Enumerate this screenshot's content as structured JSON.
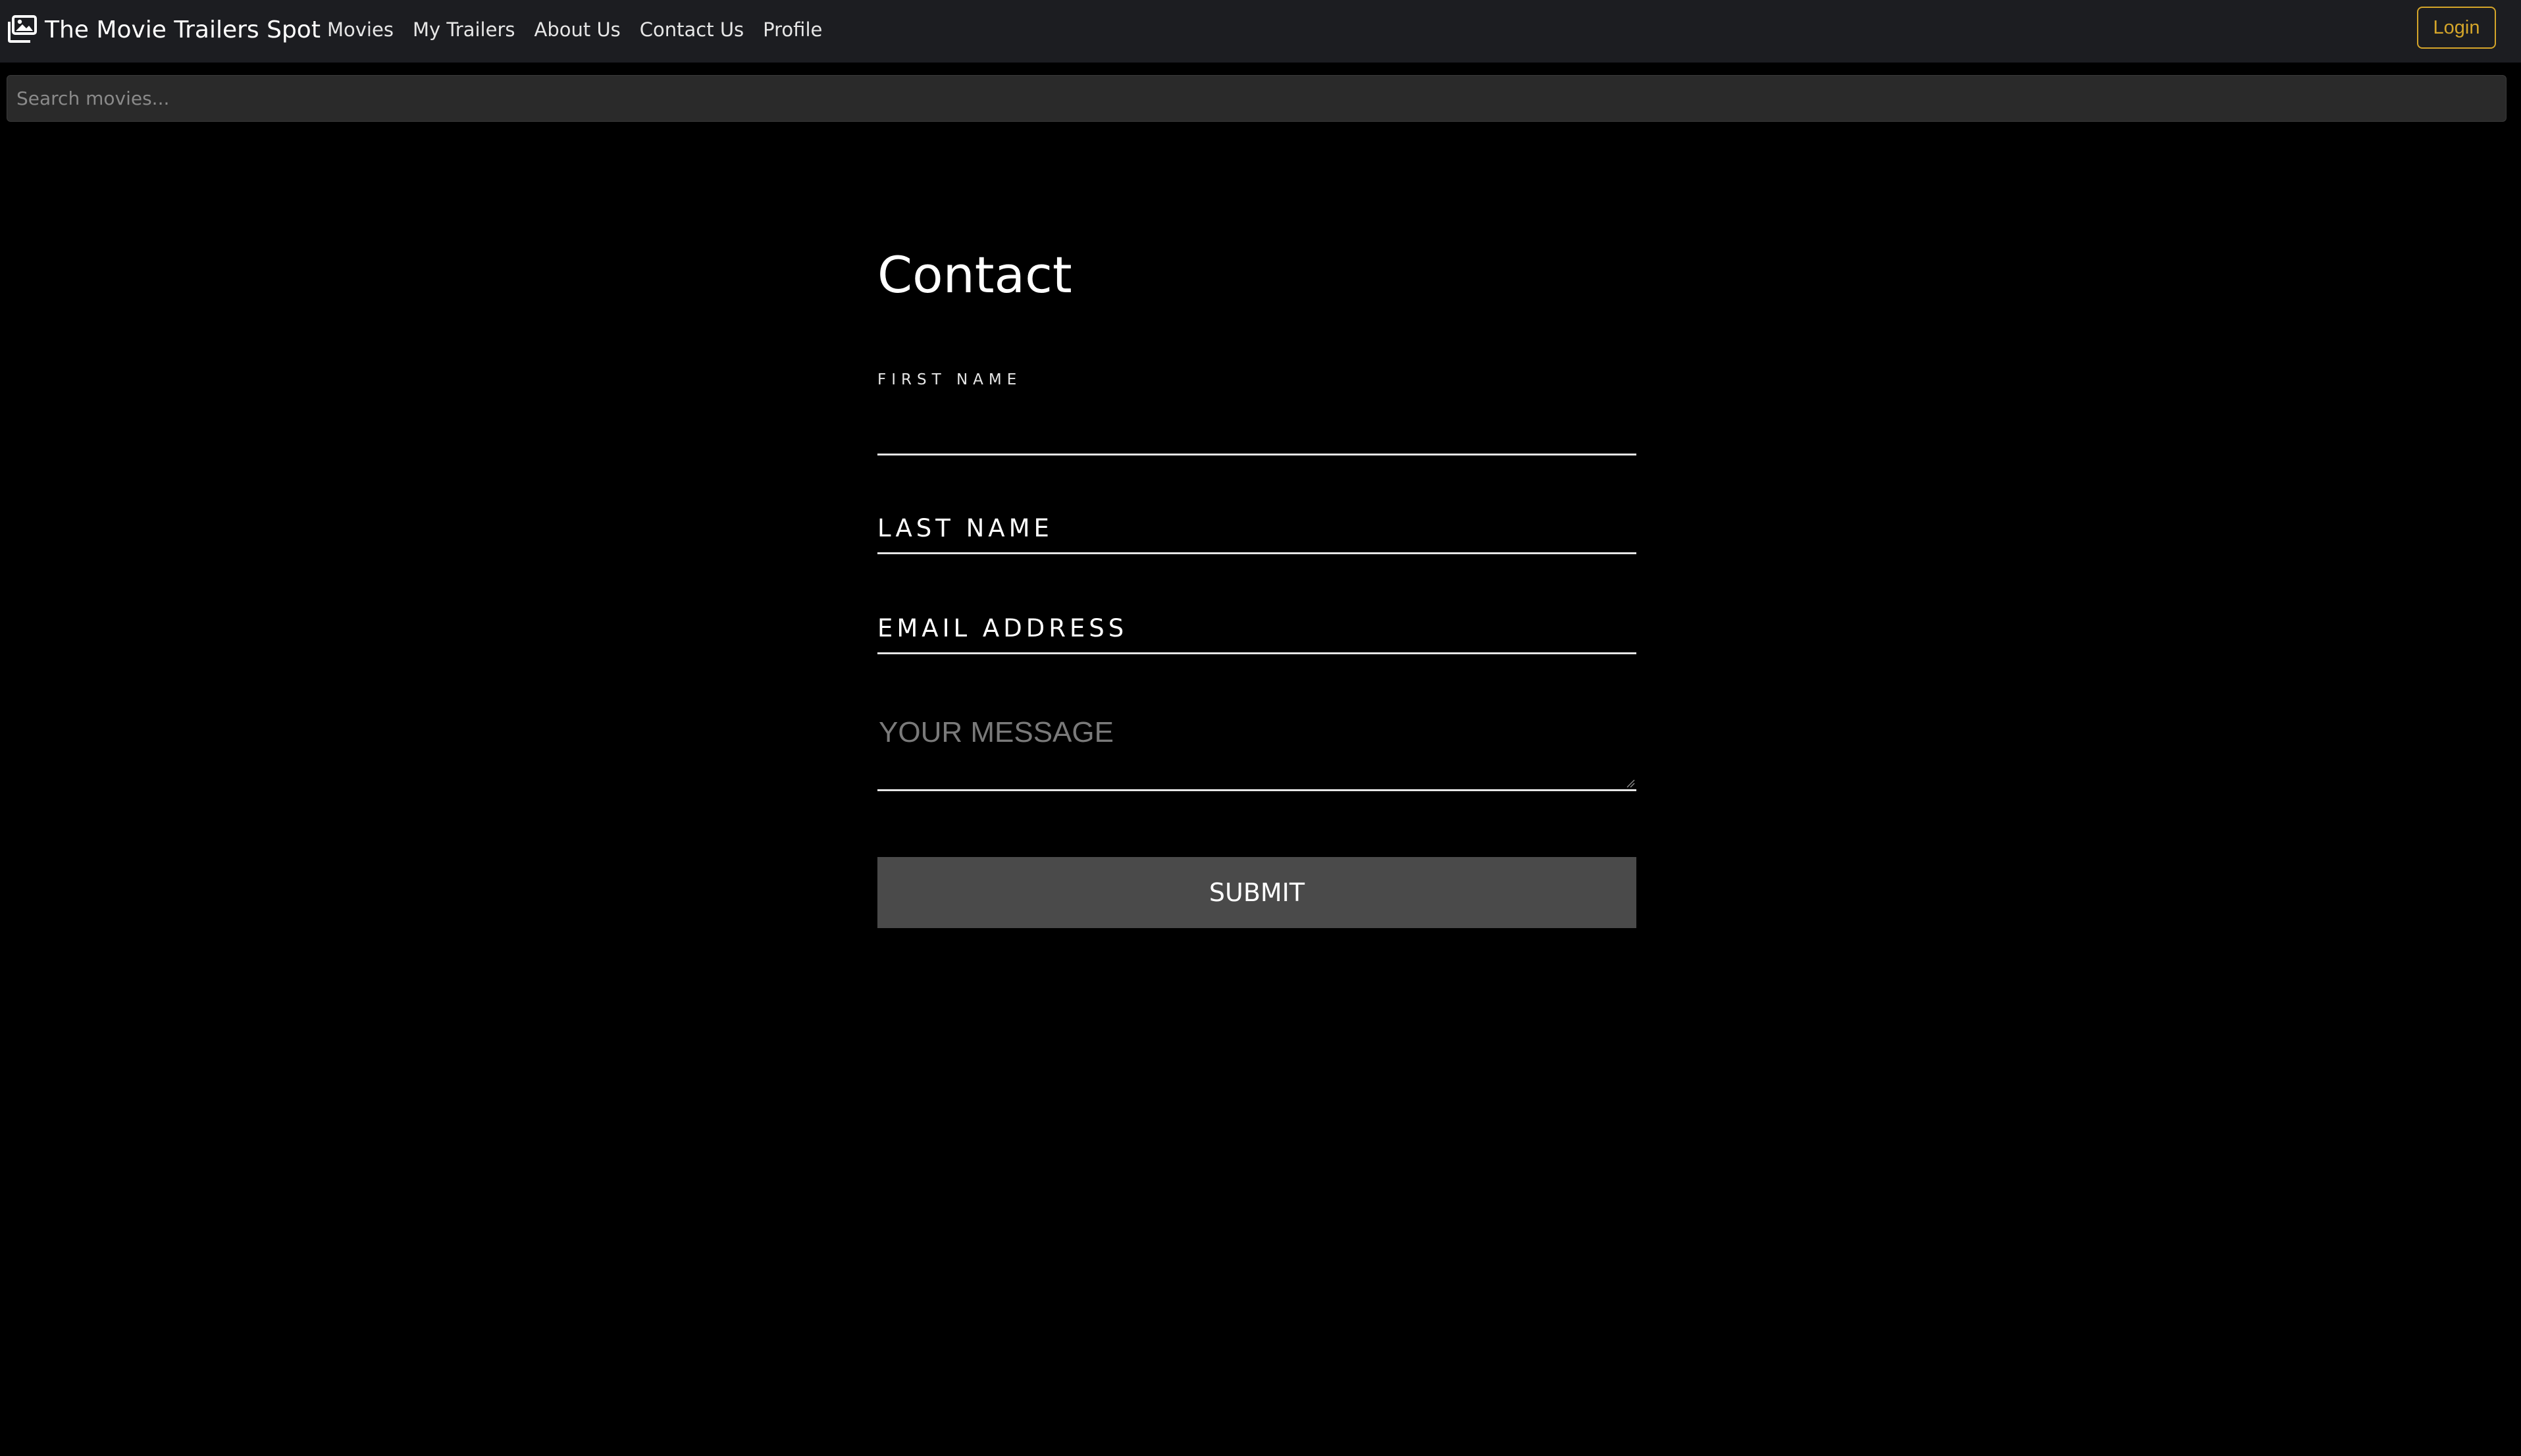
{
  "navbar": {
    "brand_icon": "film-images-icon",
    "brand": "The Movie Trailers Spot",
    "links": [
      "Movies",
      "My Trailers",
      "About Us",
      "Contact Us",
      "Profile"
    ],
    "login_label": "Login",
    "accent_color": "#d4a52a",
    "background": "#1c1d21"
  },
  "search": {
    "placeholder": "Search movies..."
  },
  "contact": {
    "title": "Contact",
    "first_name_label": "FIRST NAME",
    "first_name_value": "",
    "last_name_placeholder": "LAST NAME",
    "email_placeholder": "EMAIL ADDRESS",
    "message_placeholder": "YOUR MESSAGE",
    "submit_label": "SUBMIT",
    "submit_color": "#4a4a4a"
  }
}
